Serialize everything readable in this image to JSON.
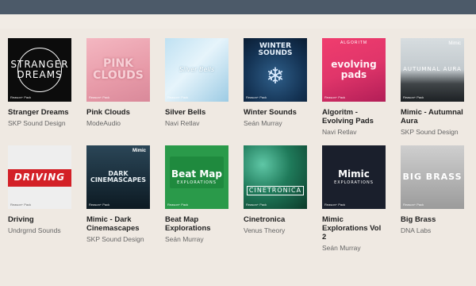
{
  "header": {
    "color": "#4c5a69"
  },
  "packs": [
    {
      "name": "Stranger Dreams",
      "author": "SKP Sound Design",
      "cover_text": "STRANGER DREAMS",
      "badge": "Reason+ Pack"
    },
    {
      "name": "Pink Clouds",
      "author": "ModeAudio",
      "cover_text": "PINK CLOUDS",
      "badge": "Reason+ Pack"
    },
    {
      "name": "Silver Bells",
      "author": "Navi Retlav",
      "cover_text": "Silver Bells",
      "badge": "Reason+ Pack"
    },
    {
      "name": "Winter Sounds",
      "author": "Seán Murray",
      "cover_text": "WINTER SOUNDS",
      "cover_icon": "❄",
      "badge": "Reason+ Pack"
    },
    {
      "name": "Algoritm - Evolving Pads",
      "author": "Navi Retlav",
      "cover_text": "evolving pads",
      "cover_tag": "ALGORITM",
      "badge": "Reason+ Pack"
    },
    {
      "name": "Mimic - Autumnal Aura",
      "author": "SKP Sound Design",
      "cover_text": "AUTUMNAL AURA",
      "brand": "Mimic",
      "badge": "Reason+ Pack"
    },
    {
      "name": "Driving",
      "author": "Undrgrnd Sounds",
      "cover_text": "DRIVING",
      "badge": "Reason+ Pack"
    },
    {
      "name": "Mimic - Dark Cinemascapes",
      "author": "SKP Sound Design",
      "cover_text": "DARK CINEMASCAPES",
      "brand": "Mimic",
      "badge": "Reason+ Pack"
    },
    {
      "name": "Beat Map Explorations",
      "author": "Seán Murray",
      "cover_text": "Beat Map",
      "cover_sub": "EXPLORATIONS",
      "badge": "Reason+ Pack"
    },
    {
      "name": "Cinetronica",
      "author": "Venus Theory",
      "cover_text": "CINETRONICA",
      "badge": "Reason+ Pack"
    },
    {
      "name": "Mimic Explorations Vol 2",
      "author": "Seán Murray",
      "cover_text": "Mimic",
      "cover_sub": "EXPLORATIONS",
      "badge": "Reason+ Pack"
    },
    {
      "name": "Big Brass",
      "author": "DNA Labs",
      "cover_text": "BIG BRASS",
      "badge": "Reason+ Pack"
    }
  ]
}
